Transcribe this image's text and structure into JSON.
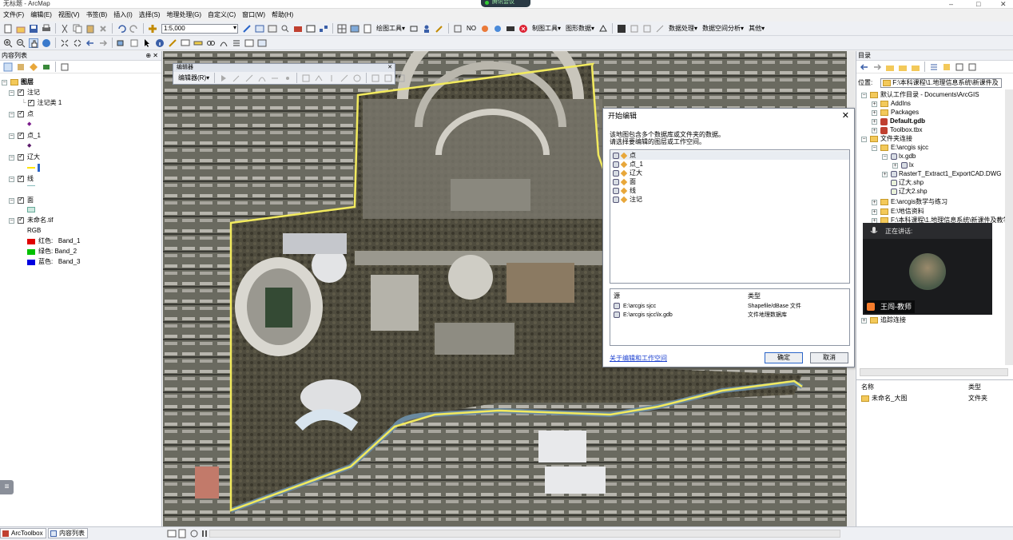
{
  "window": {
    "title": "无标题 - ArcMap",
    "meeting_label": "腾讯会议",
    "min": "–",
    "max": "□",
    "close": "✕"
  },
  "menu": [
    "文件(F)",
    "编辑(E)",
    "视图(V)",
    "书签(B)",
    "插入(I)",
    "选择(S)",
    "地理处理(G)",
    "自定义(C)",
    "窗口(W)",
    "帮助(H)"
  ],
  "toolbar": {
    "scale": "1:5,000",
    "labels": [
      "绘图工具▾",
      "NO",
      "制图工具▾",
      "图形数据▾",
      "数据处理▾",
      "数据空间分析▾",
      "其他▾"
    ]
  },
  "toc": {
    "title": "内容列表",
    "pin": "⊕ ✕",
    "root": "图层",
    "layers": [
      {
        "name": "注记",
        "child": "注记类 1"
      },
      {
        "name": "点"
      },
      {
        "name": "点_1"
      },
      {
        "name": "辽大"
      },
      {
        "name": "线"
      },
      {
        "name": "面"
      },
      {
        "name": "未命名.tif"
      }
    ],
    "rgb": "RGB",
    "bands": [
      {
        "label": "红色:",
        "band": "Band_1",
        "color": "#e00000"
      },
      {
        "label": "绿色:",
        "band": "Band_2",
        "color": "#00c000"
      },
      {
        "label": "蓝色:",
        "band": "Band_3",
        "color": "#0000e0"
      }
    ]
  },
  "editor_toolbar": {
    "title": "编辑器",
    "menu": "编辑器(R)▾",
    "close": "✕"
  },
  "dialog": {
    "title": "开始编辑",
    "close": "✕",
    "desc1": "该地图包含多个数据库或文件夹的数据。",
    "desc2": "请选择要编辑的图层或工作空间。",
    "items": [
      "点",
      "点_1",
      "辽大",
      "面",
      "线",
      "注记"
    ],
    "col_source": "源",
    "col_type": "类型",
    "sources": [
      {
        "path": "E:\\arcgis sjcc",
        "type": "Shapefile/dBase 文件"
      },
      {
        "path": "E:\\arcgis sjcc\\lx.gdb",
        "type": "文件地理数据库"
      }
    ],
    "link": "关于编辑和工作空间",
    "ok": "确定",
    "cancel": "取消"
  },
  "catalog": {
    "title": "目录",
    "location_label": "位置:",
    "location_value": "F:\\本科课程\\1.地理信息系统\\新课件及",
    "tree": [
      "默认工作目录 - Documents\\ArcGIS",
      "AddIns",
      "Packages",
      "Default.gdb",
      "Toolbox.tbx",
      "文件夹连接",
      "E:\\arcgis sjcc",
      "lx.gdb",
      "lx",
      "RasterT_Extract1_ExportCAD.DWG",
      "辽大.shp",
      "辽大2.shp",
      "E:\\arcgis数学与练习",
      "E:\\地信资料",
      "F:\\本科课程\\1.地理信息系统\\新课件及教学",
      "追踪连接"
    ],
    "col_name": "名称",
    "col_type": "类型",
    "content_name": "未命名_大图",
    "content_type": "文件夹"
  },
  "video": {
    "speaking": "正在讲话:",
    "name": "王闯-教师"
  },
  "bottom": {
    "tab1": "ArcToolbox",
    "tab2": "内容列表",
    "float": "≡"
  }
}
